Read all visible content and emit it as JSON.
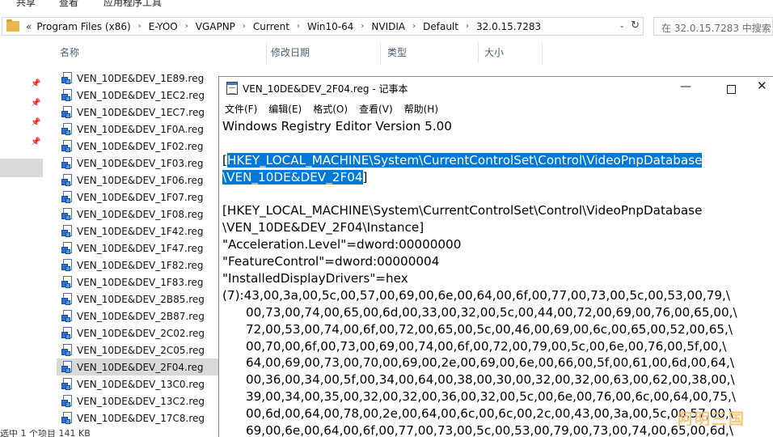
{
  "ribbon": {
    "tabs": [
      "共享",
      "查看",
      "应用程序工具"
    ]
  },
  "address_bar": {
    "more": "«",
    "crumbs": [
      "Program Files (x86)",
      "E-YOO",
      "VGAPNP",
      "Current",
      "Win10-64",
      "NVIDIA",
      "Default",
      "32.0.15.7283"
    ],
    "dropdown": "⌄",
    "refresh": "↻"
  },
  "search": {
    "placeholder": "在 32.0.15.7283 中搜索"
  },
  "columns": {
    "name": "名称",
    "modified": "修改日期",
    "type": "类型",
    "size": "大小"
  },
  "files": [
    {
      "name": "VEN_10DE&DEV_1E89.reg",
      "selected": false
    },
    {
      "name": "VEN_10DE&DEV_1EC2.reg",
      "selected": false
    },
    {
      "name": "VEN_10DE&DEV_1EC7.reg",
      "selected": false
    },
    {
      "name": "VEN_10DE&DEV_1F0A.reg",
      "selected": false
    },
    {
      "name": "VEN_10DE&DEV_1F02.reg",
      "selected": false
    },
    {
      "name": "VEN_10DE&DEV_1F03.reg",
      "selected": false
    },
    {
      "name": "VEN_10DE&DEV_1F06.reg",
      "selected": false
    },
    {
      "name": "VEN_10DE&DEV_1F07.reg",
      "selected": false
    },
    {
      "name": "VEN_10DE&DEV_1F08.reg",
      "selected": false
    },
    {
      "name": "VEN_10DE&DEV_1F42.reg",
      "selected": false
    },
    {
      "name": "VEN_10DE&DEV_1F47.reg",
      "selected": false
    },
    {
      "name": "VEN_10DE&DEV_1F82.reg",
      "selected": false
    },
    {
      "name": "VEN_10DE&DEV_1F83.reg",
      "selected": false
    },
    {
      "name": "VEN_10DE&DEV_2B85.reg",
      "selected": false
    },
    {
      "name": "VEN_10DE&DEV_2B87.reg",
      "selected": false
    },
    {
      "name": "VEN_10DE&DEV_2C02.reg",
      "selected": false
    },
    {
      "name": "VEN_10DE&DEV_2C05.reg",
      "selected": false
    },
    {
      "name": "VEN_10DE&DEV_2F04.reg",
      "selected": true
    },
    {
      "name": "VEN_10DE&DEV_13C0.reg",
      "selected": false
    },
    {
      "name": "VEN_10DE&DEV_13C2.reg",
      "selected": false
    },
    {
      "name": "VEN_10DE&DEV_17C8.reg",
      "selected": false
    }
  ],
  "status_bar": {
    "text": "选中 1 个项目  141 KB"
  },
  "notepad": {
    "title": "VEN_10DE&DEV_2F04.reg - 记事本",
    "controls": {
      "minimize": "—",
      "close": "✕"
    },
    "menu": [
      "文件(F)",
      "编辑(E)",
      "格式(O)",
      "查看(V)",
      "帮助(H)"
    ],
    "lines": [
      {
        "text": "Windows Registry Editor Version 5.00",
        "highlight": false
      },
      {
        "text": "",
        "highlight": false
      },
      {
        "text": "[",
        "after": "HKEY_LOCAL_MACHINE\\System\\CurrentControlSet\\Control\\VideoPnpDatabase",
        "highlight": "partial"
      },
      {
        "text": "\\VEN_10DE&DEV_2F04",
        "after": "]",
        "highlight": "lead"
      },
      {
        "text": "",
        "highlight": false
      },
      {
        "text": "[HKEY_LOCAL_MACHINE\\System\\CurrentControlSet\\Control\\VideoPnpDatabase",
        "highlight": false
      },
      {
        "text": "\\VEN_10DE&DEV_2F04\\Instance]",
        "highlight": false
      },
      {
        "text": "\"Acceleration.Level\"=dword:00000000",
        "highlight": false
      },
      {
        "text": "\"FeatureControl\"=dword:00000004",
        "highlight": false
      },
      {
        "text": "\"InstalledDisplayDrivers\"=hex",
        "highlight": false
      },
      {
        "text": "(7):43,00,3a,00,5c,00,57,00,69,00,6e,00,64,00,6f,00,77,00,73,00,5c,00,53,00,79,\\",
        "highlight": false
      },
      {
        "text": "      00,73,00,74,00,65,00,6d,00,33,00,32,00,5c,00,44,00,72,00,69,00,76,00,65,00,\\",
        "highlight": false
      },
      {
        "text": "      72,00,53,00,74,00,6f,00,72,00,65,00,5c,00,46,00,69,00,6c,00,65,00,52,00,65,\\",
        "highlight": false
      },
      {
        "text": "      00,70,00,6f,00,73,00,69,00,74,00,6f,00,72,00,79,00,5c,00,6e,00,76,00,5f,00,\\",
        "highlight": false
      },
      {
        "text": "      64,00,69,00,73,00,70,00,69,00,2e,00,69,00,6e,00,66,00,5f,00,61,00,6d,00,64,\\",
        "highlight": false
      },
      {
        "text": "      00,36,00,34,00,5f,00,34,00,64,00,38,00,30,00,32,00,32,00,63,00,62,00,38,00,\\",
        "highlight": false
      },
      {
        "text": "      39,00,34,00,35,00,32,00,32,00,36,00,32,00,5c,00,6e,00,76,00,6c,00,64,00,75,\\",
        "highlight": false
      },
      {
        "text": "      00,6d,00,64,00,78,00,2e,00,64,00,6c,00,6c,00,2c,00,43,00,3a,00,5c,00,57,00,\\",
        "highlight": false
      },
      {
        "text": "      69,00,6e,00,64,00,6f,00,77,00,73,00,5c,00,53,00,79,00,73,00,74,00,65,00,6d,\\",
        "highlight": false
      }
    ]
  },
  "watermark": {
    "text": "阿明三国"
  }
}
